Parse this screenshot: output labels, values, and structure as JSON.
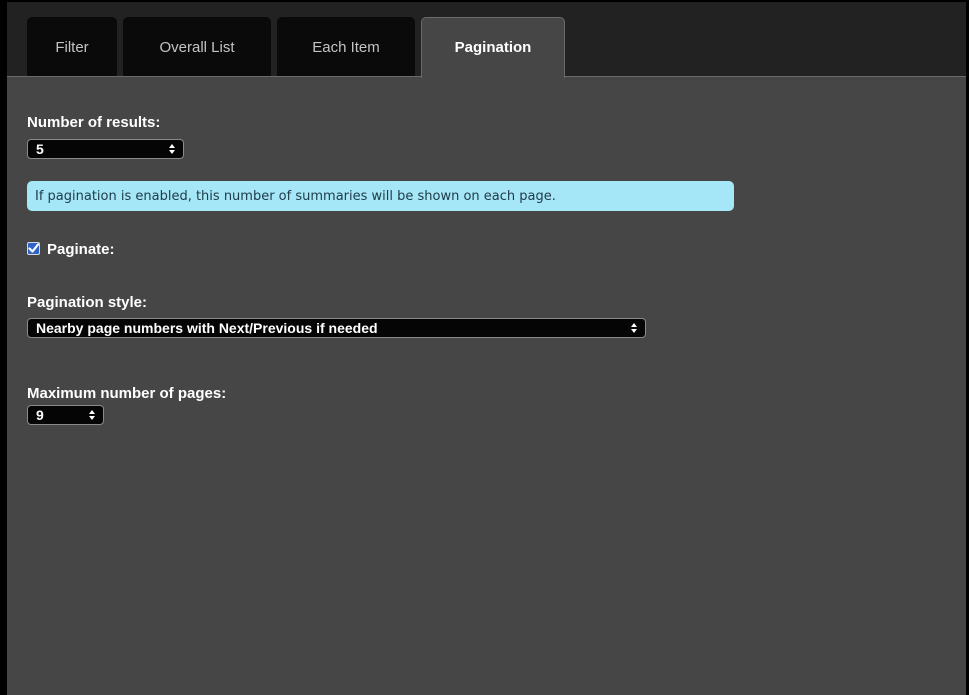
{
  "tabs": [
    {
      "label": "Filter",
      "active": false
    },
    {
      "label": "Overall List",
      "active": false
    },
    {
      "label": "Each Item",
      "active": false
    },
    {
      "label": "Pagination",
      "active": true
    }
  ],
  "form": {
    "num_results": {
      "label": "Number of results:",
      "value": "5",
      "help": "If pagination is enabled, this number of summaries will be shown on each page."
    },
    "paginate": {
      "label": "Paginate:",
      "checked": true
    },
    "pagination_style": {
      "label": "Pagination style:",
      "value": "Nearby page numbers with Next/Previous if needed"
    },
    "max_pages": {
      "label": "Maximum number of pages:",
      "value": "9"
    }
  },
  "colors": {
    "panel_bg": "#464646",
    "tabbar_bg": "#222222",
    "info_bg": "#a5e6f7",
    "checkbox_accent": "#2f63c7"
  }
}
